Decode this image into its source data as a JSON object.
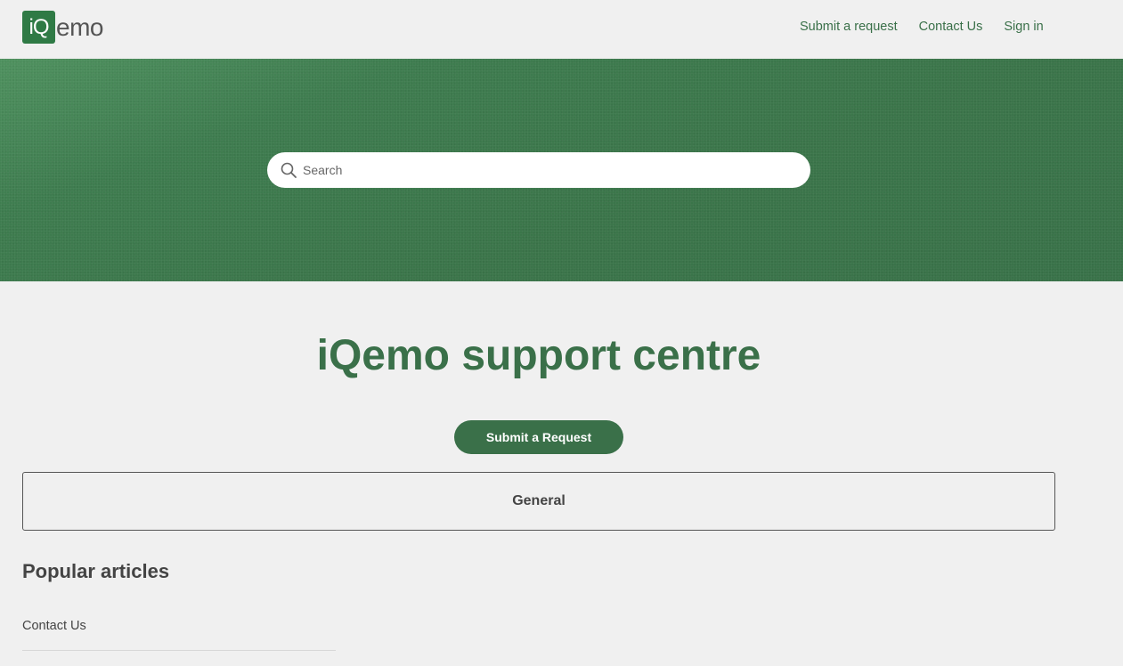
{
  "header": {
    "logo": {
      "mark": "iQ",
      "rest": "emo"
    },
    "nav": [
      {
        "label": "Submit a request"
      },
      {
        "label": "Contact Us"
      },
      {
        "label": "Sign in"
      }
    ]
  },
  "hero": {
    "search": {
      "placeholder": "Search",
      "value": ""
    }
  },
  "main": {
    "title": "iQemo support centre",
    "submit_button_label": "Submit a Request",
    "categories": [
      {
        "label": "General"
      }
    ],
    "popular": {
      "heading": "Popular articles",
      "articles": [
        {
          "label": "Contact Us"
        }
      ]
    }
  },
  "colors": {
    "brand_green": "#3a7049",
    "logo_green": "#2f7a45",
    "background": "#f0f0f0"
  },
  "icons": {
    "search": "search-icon"
  }
}
